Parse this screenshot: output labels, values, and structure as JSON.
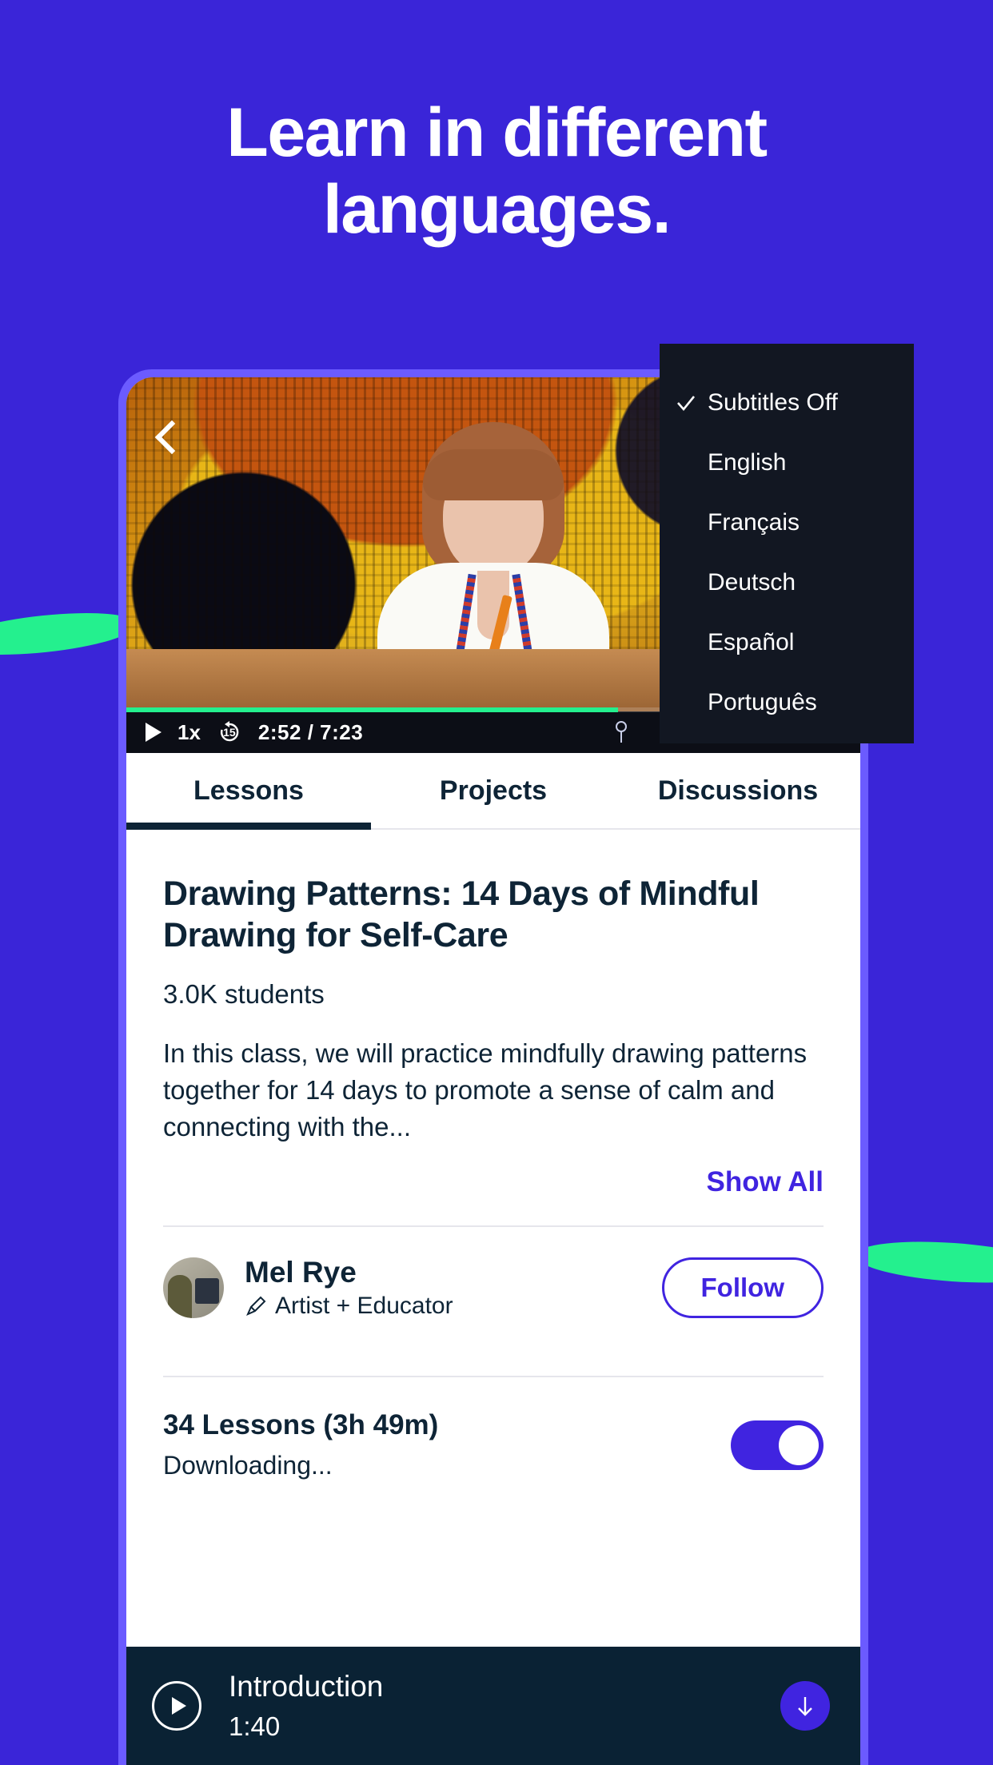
{
  "hero": {
    "line1": "Learn in different",
    "line2": "languages."
  },
  "colors": {
    "background": "#3A25D8",
    "accent_green": "#24F08E",
    "brand_purple": "#4024E0",
    "phone_frame": "#6B5BFF",
    "dark_navy": "#0E2436",
    "menu_dark": "#121722",
    "lesson_dark": "#0A2234"
  },
  "video": {
    "back_icon": "chevron-left-icon",
    "bookmark_icon": "bookmark-icon"
  },
  "subtitle_menu": {
    "items": [
      {
        "label": "Subtitles Off",
        "selected": true
      },
      {
        "label": "English",
        "selected": false
      },
      {
        "label": "Français",
        "selected": false
      },
      {
        "label": "Deutsch",
        "selected": false
      },
      {
        "label": "Español",
        "selected": false
      },
      {
        "label": "Português",
        "selected": false
      }
    ],
    "check_icon": "check-icon"
  },
  "player": {
    "play_icon": "play-icon",
    "speed": "1x",
    "rewind_label": "15",
    "rewind_icon": "rewind-15-icon",
    "current_time": "2:52",
    "separator": "/",
    "total_time": "7:23",
    "progress_percent": 67,
    "right_icons": [
      "cast-icon",
      "volume-icon",
      "subtitles-icon",
      "settings-gear-icon",
      "fullscreen-icon"
    ]
  },
  "tabs": [
    {
      "label": "Lessons",
      "active": true
    },
    {
      "label": "Projects",
      "active": false
    },
    {
      "label": "Discussions",
      "active": false
    }
  ],
  "course": {
    "title": "Drawing Patterns: 14 Days of Mindful Drawing for Self-Care",
    "students": "3.0K students",
    "description": "In this class, we will practice mindfully drawing patterns together for 14 days to promote a sense of calm and connecting with the...",
    "show_all_label": "Show All"
  },
  "instructor": {
    "name": "Mel Rye",
    "title": "Artist + Educator",
    "title_icon": "pencil-icon",
    "follow_label": "Follow",
    "avatar": "instructor-avatar"
  },
  "lessons": {
    "count_label": "34 Lessons (3h 49m)",
    "status": "Downloading...",
    "toggle_on": true
  },
  "current_lesson": {
    "title": "Introduction",
    "duration": "1:40",
    "play_icon": "play-circle-icon",
    "download_icon": "download-arrow-icon"
  }
}
